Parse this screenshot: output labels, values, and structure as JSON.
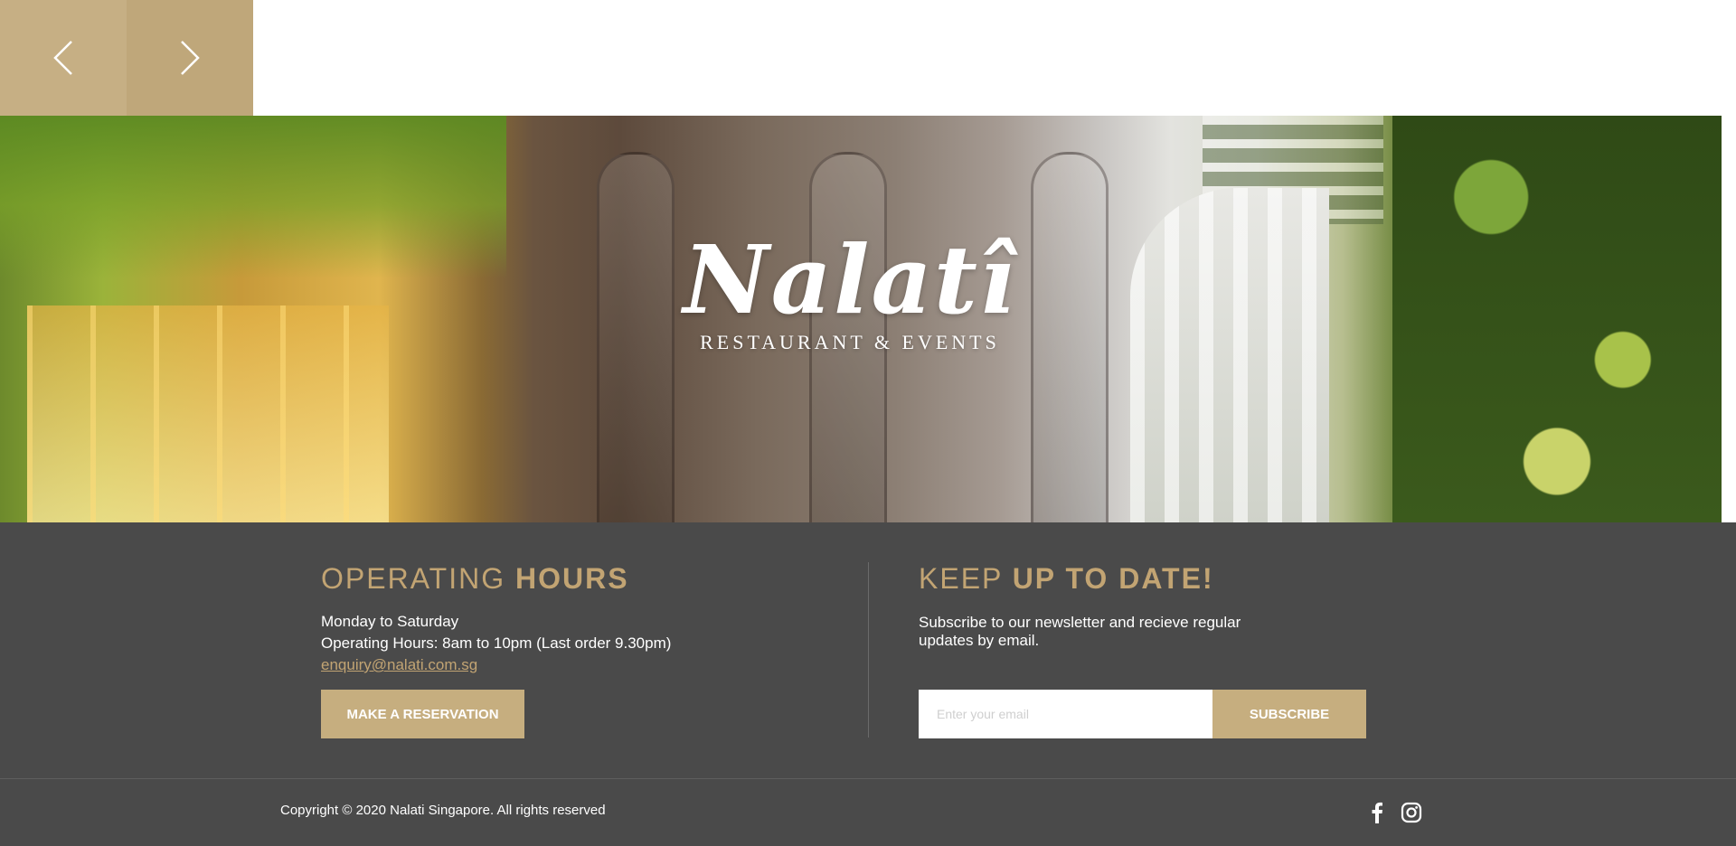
{
  "slider": {
    "prev_icon": "chevron-left-icon",
    "next_icon": "chevron-right-icon"
  },
  "hero": {
    "logo_script": "Nalatî",
    "logo_sub": "RESTAURANT & EVENTS"
  },
  "operating_hours": {
    "title_light": "OPERATING ",
    "title_bold": "HOURS",
    "line1": "Monday to Saturday",
    "line2": "Operating Hours: 8am to 10pm (Last order 9.30pm)",
    "email": "enquiry@nalati.com.sg",
    "reserve_label": "MAKE A RESERVATION"
  },
  "newsletter": {
    "title_light": "KEEP ",
    "title_bold": "UP TO DATE!",
    "description": "Subscribe to our newsletter and recieve regular updates by email.",
    "email_placeholder": "Enter your email",
    "subscribe_label": "SUBSCRIBE"
  },
  "footer": {
    "copyright": "Copyright © 2020 Nalati Singapore. All rights reserved",
    "social": [
      "facebook-icon",
      "instagram-icon"
    ]
  },
  "colors": {
    "accent_gold": "#c2a473",
    "button_gold": "#c6ae7f",
    "footer_bg": "#4a4a4a"
  }
}
